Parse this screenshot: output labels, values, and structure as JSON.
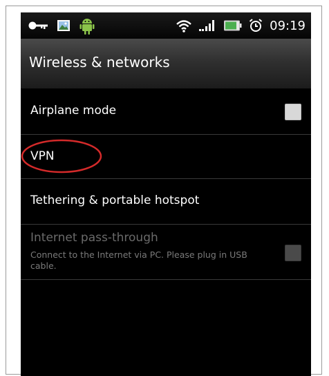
{
  "status_bar": {
    "time": "09:19",
    "icons": [
      "key-icon",
      "image-icon",
      "android-icon",
      "wifi-icon",
      "signal-icon",
      "battery-icon",
      "alarm-icon"
    ],
    "battery_color": "#4caf50"
  },
  "header": {
    "title": "Wireless & networks"
  },
  "settings": {
    "airplane": {
      "label": "Airplane mode",
      "checked": false
    },
    "vpn": {
      "label": "VPN"
    },
    "tethering": {
      "label": "Tethering & portable hotspot"
    },
    "internet_pass_through": {
      "label": "Internet pass-through",
      "summary": "Connect to the Internet via PC. Please plug in USB cable.",
      "enabled": false,
      "checked": false
    }
  },
  "annotation_color": "#d42a2a"
}
